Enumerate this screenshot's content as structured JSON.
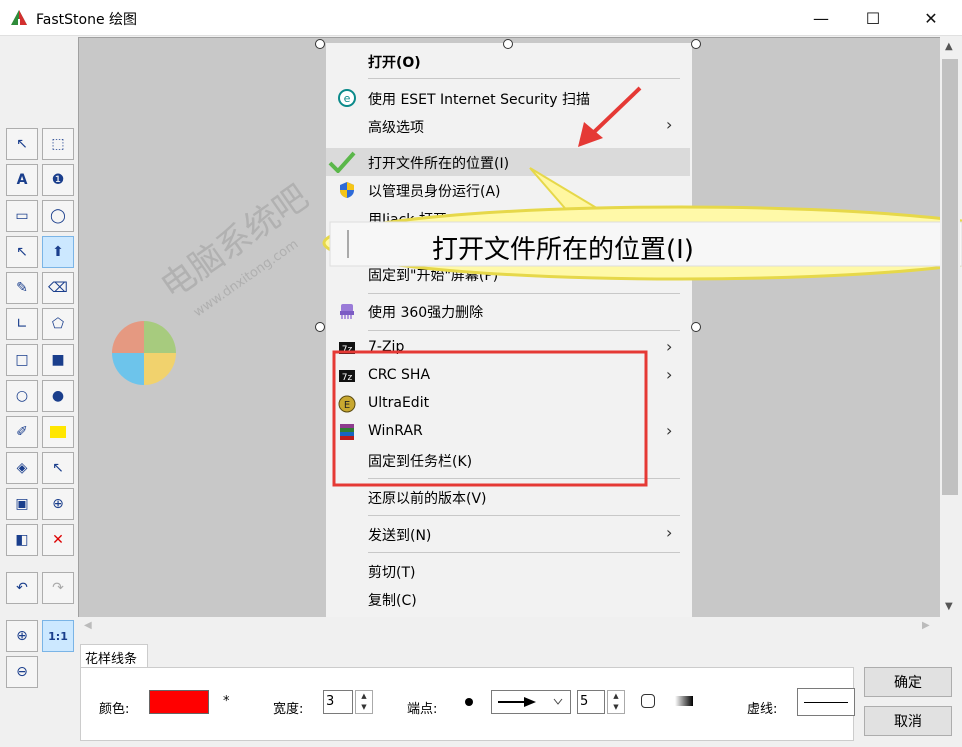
{
  "window": {
    "title": "FastStone 绘图",
    "minimize": "—",
    "maximize": "☐",
    "close": "✕"
  },
  "toolbar": {
    "zoom_1_1": "1:1"
  },
  "menu": {
    "items": [
      {
        "label": "打开(O)"
      },
      {
        "label": "使用 ESET Internet Security 扫描"
      },
      {
        "label": "高级选项"
      },
      {
        "label": "打开文件所在的位置(I)"
      },
      {
        "label": "以管理员身份运行(A)"
      },
      {
        "label": "用Jiack 打开"
      },
      {
        "label": "固定到\"开始\"屏幕(P)"
      },
      {
        "label": "使用 360强力删除"
      },
      {
        "label": "7-Zip"
      },
      {
        "label": "CRC SHA"
      },
      {
        "label": "UltraEdit"
      },
      {
        "label": "WinRAR"
      },
      {
        "label": "固定到任务栏(K)"
      },
      {
        "label": "还原以前的版本(V)"
      },
      {
        "label": "发送到(N)"
      },
      {
        "label": "剪切(T)"
      },
      {
        "label": "复制(C)"
      }
    ]
  },
  "callout": {
    "text": "打开文件所在的位置(I)"
  },
  "watermark": {
    "text": "电脑系统吧",
    "url": "www.dnxitong.com"
  },
  "bottom": {
    "tab": "花样线条",
    "color_label": "颜色:",
    "asterisk": "*",
    "color_value": "#ff0000",
    "width_label": "宽度:",
    "width_value": "3",
    "endpoint_label": "端点:",
    "endpoint_size": "5",
    "dash_label": "虚线:",
    "ok": "确定",
    "cancel": "取消"
  }
}
